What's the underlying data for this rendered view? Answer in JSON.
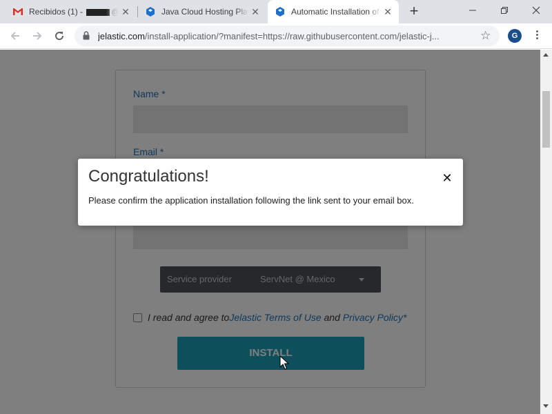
{
  "browser": {
    "tabs": [
      {
        "title_prefix": "Recibidos (1) - ",
        "title_suffix": "@",
        "icon": "gmail-icon"
      },
      {
        "title": "Java Cloud Hosting Platform",
        "icon": "jelastic-icon"
      },
      {
        "title": "Automatic Installation of",
        "icon": "jelastic-icon"
      }
    ],
    "new_tab_label": "+",
    "url_host": "jelastic.com",
    "url_rest": "/install-application/?manifest=https://raw.githubusercontent.com/jelastic-j...",
    "profile_initial": "G",
    "window_controls": [
      "minimize",
      "restore",
      "close"
    ]
  },
  "form": {
    "name_label": "Name *",
    "email_label": "Email *",
    "provider_label": "Service provider",
    "provider_value": "ServNet @ Mexico",
    "agree_prefix": "I read and agree to ",
    "terms_link": "Jelastic Terms of Use",
    "agree_middle": " and ",
    "privacy_link": "Privacy Policy*",
    "install_label": "INSTALL"
  },
  "modal": {
    "title": "Congratulations!",
    "message": "Please confirm the application installation following the link sent to your email box.",
    "close_glyph": "✕"
  },
  "colors": {
    "accent_blue": "#1a73b8",
    "install_button": "#1a9fb5",
    "provider_bg": "#4d5157",
    "gmail_red": "#d93025",
    "jelastic_blue": "#1e6fc5"
  }
}
